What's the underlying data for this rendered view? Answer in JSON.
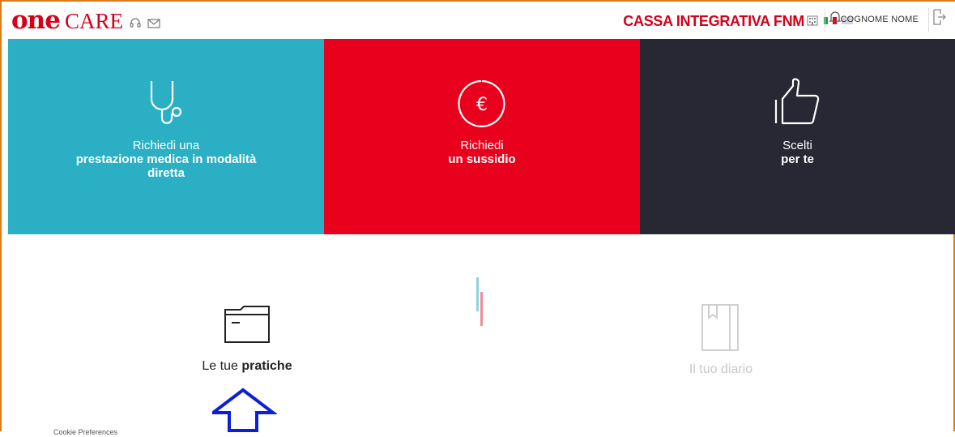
{
  "header": {
    "logo_one": "one",
    "logo_care": "CARE",
    "org_name": "CASSA INTEGRATIVA FNM",
    "user_name": "COGNOME NOME",
    "icons": [
      "headset-icon",
      "mail-icon",
      "building-icon",
      "italian-flag-icon",
      "english-flag-icon",
      "bell-icon",
      "logout-icon"
    ]
  },
  "tiles": [
    {
      "line1": "Richiedi una",
      "line2": "prestazione medica in modalità diretta",
      "icon": "stethoscope-icon",
      "color": "#2aafc4"
    },
    {
      "line1": "Richiedi",
      "line2": "un sussidio",
      "icon": "euro-icon",
      "color": "#e8001c"
    },
    {
      "line1": "Scelti",
      "line2": "per te",
      "icon": "thumbs-up-icon",
      "color": "#272833"
    }
  ],
  "lower": {
    "pratiche_prefix": "Le tue",
    "pratiche_bold": "pratiche",
    "diario_prefix": "Il tuo",
    "diario_bold": "diario"
  },
  "footer": {
    "cookie": "Cookie Preferences"
  },
  "colors": {
    "brand_red": "#d40019",
    "teal": "#2aafc4",
    "red": "#e8001c",
    "dark": "#272833",
    "annotation_arrow": "#0a1fd6"
  }
}
